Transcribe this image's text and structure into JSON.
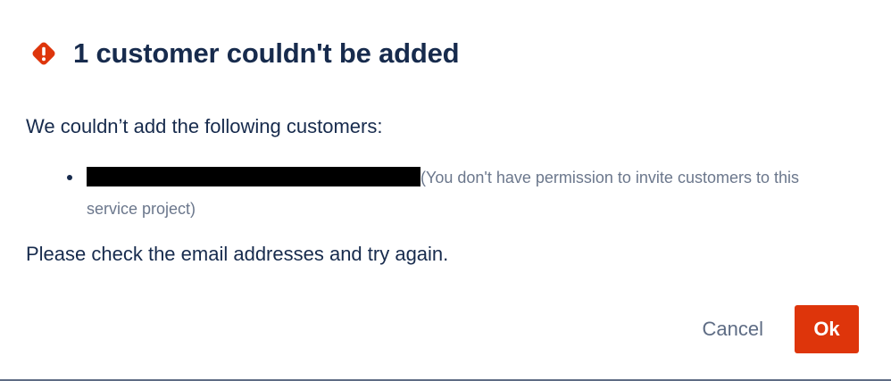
{
  "dialog": {
    "title": "1 customer couldn't be added",
    "icon": "warning-icon",
    "accent_color": "#de350b",
    "intro": "We couldn’t add the following customers:",
    "failures": [
      {
        "email": "[redacted]",
        "reason": "(You don't have permission to invite customers to this service project)"
      }
    ],
    "footer": "Please check the email addresses and try again.",
    "buttons": {
      "cancel": "Cancel",
      "ok": "Ok"
    }
  }
}
